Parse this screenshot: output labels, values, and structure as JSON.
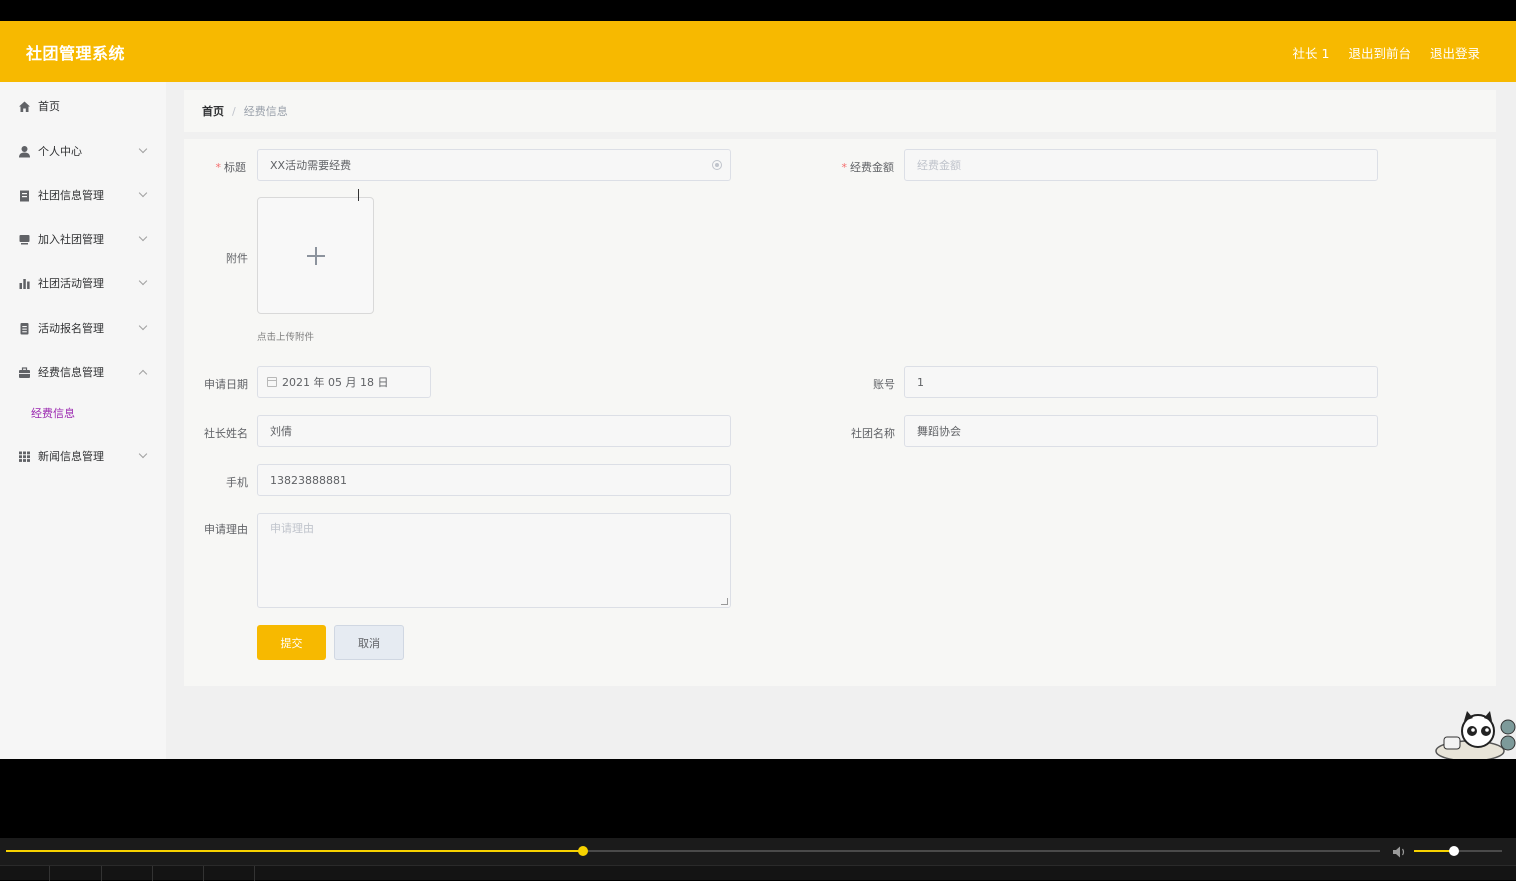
{
  "header": {
    "brand": "社团管理系统",
    "user": "社长 1",
    "to_frontend": "退出到前台",
    "logout": "退出登录"
  },
  "sidebar": {
    "items": [
      {
        "label": "首页",
        "icon": "home-icon"
      },
      {
        "label": "个人中心",
        "icon": "user-icon"
      },
      {
        "label": "社团信息管理",
        "icon": "clipboard-icon"
      },
      {
        "label": "加入社团管理",
        "icon": "monitor-icon"
      },
      {
        "label": "社团活动管理",
        "icon": "bar-chart-icon"
      },
      {
        "label": "活动报名管理",
        "icon": "document-icon"
      },
      {
        "label": "经费信息管理",
        "icon": "briefcase-icon"
      },
      {
        "label": "新闻信息管理",
        "icon": "grid-icon"
      }
    ],
    "sub_active": "经费信息"
  },
  "breadcrumb": {
    "home": "首页",
    "sep": "/",
    "current": "经费信息"
  },
  "form": {
    "title_label": "标题",
    "title_value": "XX活动需要经费",
    "amount_label": "经费金额",
    "amount_placeholder": "经费金额",
    "attachment_label": "附件",
    "attachment_tip": "点击上传附件",
    "date_label": "申请日期",
    "date_value": "2021 年 05 月 18 日",
    "account_label": "账号",
    "account_value": "1",
    "leader_label": "社长姓名",
    "leader_value": "刘倩",
    "club_label": "社团名称",
    "club_value": "舞蹈协会",
    "phone_label": "手机",
    "phone_value": "13823888881",
    "reason_label": "申请理由",
    "reason_placeholder": "申请理由",
    "submit": "提交",
    "cancel": "取消"
  },
  "player": {
    "progress": 0.42,
    "volume": 0.45,
    "accent": "#f7d200"
  },
  "colors": {
    "accent": "#f7b900",
    "active_sub": "#9b27b0"
  }
}
